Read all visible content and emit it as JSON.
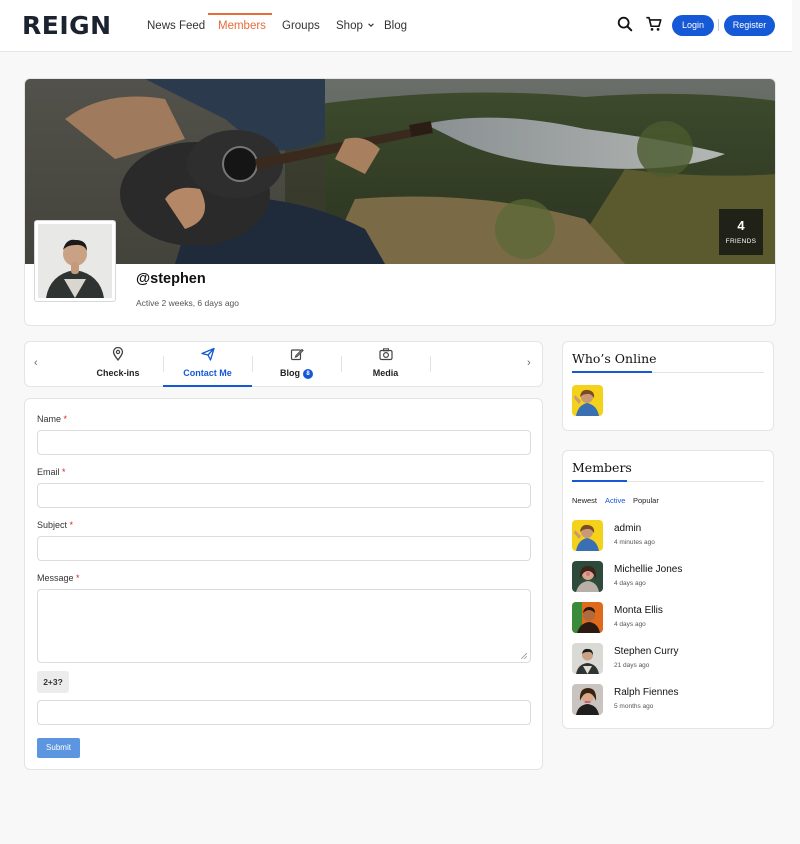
{
  "brand": {
    "logo": "REIGN",
    "accent": "#e96b3a",
    "primary": "#1559d6"
  },
  "nav": {
    "items": [
      {
        "label": "News Feed"
      },
      {
        "label": "Members"
      },
      {
        "label": "Groups"
      },
      {
        "label": "Shop"
      },
      {
        "label": "Blog"
      }
    ],
    "active": "Members",
    "login_label": "Login",
    "register_label": "Register",
    "icons": [
      "search-icon",
      "cart-icon",
      "chevron-down-icon"
    ]
  },
  "profile": {
    "username": "@stephen",
    "status": "Active 2 weeks, 6 days ago",
    "friends_count": "4",
    "friends_label": "FRIENDS"
  },
  "tabs": {
    "items": [
      {
        "label": "Check-ins",
        "icon": "map-pin-icon"
      },
      {
        "label": "Contact Me",
        "icon": "send-icon"
      },
      {
        "label": "Blog",
        "icon": "edit-icon",
        "badge": "8"
      },
      {
        "label": "Media",
        "icon": "camera-icon"
      }
    ],
    "active": "Contact Me"
  },
  "form": {
    "name_label": "Name",
    "email_label": "Email",
    "subject_label": "Subject",
    "message_label": "Message",
    "required_mark": "*",
    "captcha_question": "2+3?",
    "submit_label": "Submit"
  },
  "whos_online": {
    "title": "Who’s Online",
    "members": [
      {
        "avatar": "admin-avatar"
      }
    ]
  },
  "members_widget": {
    "title": "Members",
    "filters": [
      "Newest",
      "Active",
      "Popular"
    ],
    "active_filter": "Active",
    "list": [
      {
        "name": "admin",
        "time": "4 minutes ago"
      },
      {
        "name": "Michellie Jones",
        "time": "4 days ago"
      },
      {
        "name": "Monta Ellis",
        "time": "4 days ago"
      },
      {
        "name": "Stephen Curry",
        "time": "21 days ago"
      },
      {
        "name": "Ralph Fiennes",
        "time": "5 months ago"
      }
    ]
  }
}
